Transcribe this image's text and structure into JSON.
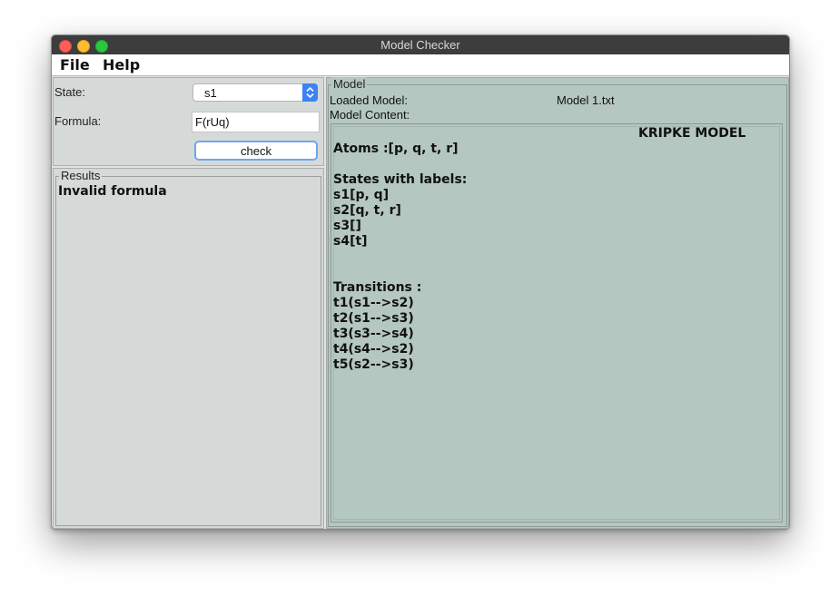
{
  "window": {
    "title": "Model Checker"
  },
  "menu": {
    "file": "File",
    "help": "Help"
  },
  "form": {
    "state_label": "State:",
    "state_value": "s1",
    "formula_label": "Formula:",
    "formula_value": "F(rUq)",
    "check_label": "check"
  },
  "results": {
    "legend": "Results",
    "text": "Invalid formula"
  },
  "model": {
    "legend": "Model",
    "loaded_label": "Loaded Model:",
    "loaded_value": "Model 1.txt",
    "content_label": "Model Content:",
    "content_title": "KRIPKE MODEL",
    "atoms": "Atoms :[p, q, t, r]",
    "states_header": "States with labels:",
    "states": [
      "s1[p, q]",
      "s2[q, t, r]",
      "s3[]",
      "s4[t]"
    ],
    "transitions_header": "Transitions :",
    "transitions": [
      "t1(s1-->s2)",
      "t2(s1-->s3)",
      "t3(s3-->s4)",
      "t4(s4-->s2)",
      "t5(s2-->s3)"
    ]
  },
  "colors": {
    "window_chrome": "#3d3d3d",
    "left_panel": "#d5dad8",
    "model_panel": "#b4c7c0",
    "accent": "#3b82f6"
  }
}
